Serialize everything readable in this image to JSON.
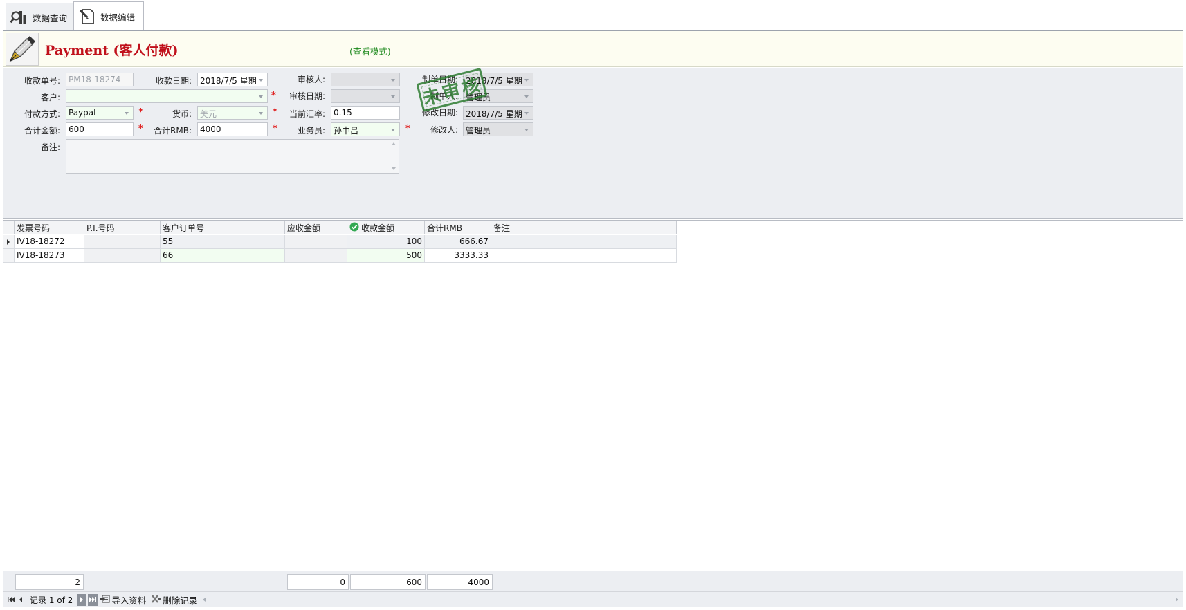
{
  "tabs": [
    {
      "label": "数据查询",
      "icon": "search-chart-icon",
      "active": false
    },
    {
      "label": "数据编辑",
      "icon": "edit-document-icon",
      "active": true
    }
  ],
  "banner": {
    "title": "Payment (客人付款)",
    "mode": "(查看模式)",
    "logo_icon": "fountain-pen-icon",
    "title_color": "#c0101b",
    "mode_color": "#1f8a1f"
  },
  "stamp": {
    "text": "未审核",
    "color": "#2e7d32"
  },
  "form": {
    "receipt_no": {
      "label": "收款单号:",
      "value": "PM18-18274"
    },
    "receipt_date": {
      "label": "收款日期:",
      "value": "2018/7/5 星期"
    },
    "customer": {
      "label": "客户:",
      "value": ""
    },
    "pay_method": {
      "label": "付款方式:",
      "value": "Paypal"
    },
    "currency": {
      "label": "货币:",
      "value": "美元"
    },
    "total_amount": {
      "label": "合计金额:",
      "value": "600"
    },
    "total_rmb": {
      "label": "合计RMB:",
      "value": "4000"
    },
    "reviewer": {
      "label": "审核人:",
      "value": ""
    },
    "review_date": {
      "label": "审核日期:",
      "value": ""
    },
    "exchange_rate": {
      "label": "当前汇率:",
      "value": "0.15"
    },
    "salesman": {
      "label": "业务员:",
      "value": "孙中吕"
    },
    "created_date": {
      "label": "制单日期:",
      "value": "2018/7/5 星期"
    },
    "creator": {
      "label": "制单人:",
      "value": "管理员"
    },
    "modified_date": {
      "label": "修改日期:",
      "value": "2018/7/5 星期"
    },
    "modifier": {
      "label": "修改人:",
      "value": "管理员"
    },
    "remark": {
      "label": "备注:",
      "value": ""
    },
    "required_mark": "*"
  },
  "grid": {
    "columns": [
      "发票号码",
      "P.I.号码",
      "客户订单号",
      "应收金额",
      "收款金额",
      "合计RMB",
      "备注"
    ],
    "rows": [
      [
        "IV18-18272",
        "",
        "55",
        "",
        "100",
        "666.67",
        ""
      ],
      [
        "IV18-18273",
        "",
        "66",
        "",
        "500",
        "3333.33",
        ""
      ]
    ],
    "totals": {
      "count": "2",
      "receivable": "0",
      "received": "600",
      "rmb": "4000"
    }
  },
  "navigator": {
    "record_text": "记录 1 of 2",
    "import_label": "导入资料",
    "delete_label": "删除记录"
  }
}
